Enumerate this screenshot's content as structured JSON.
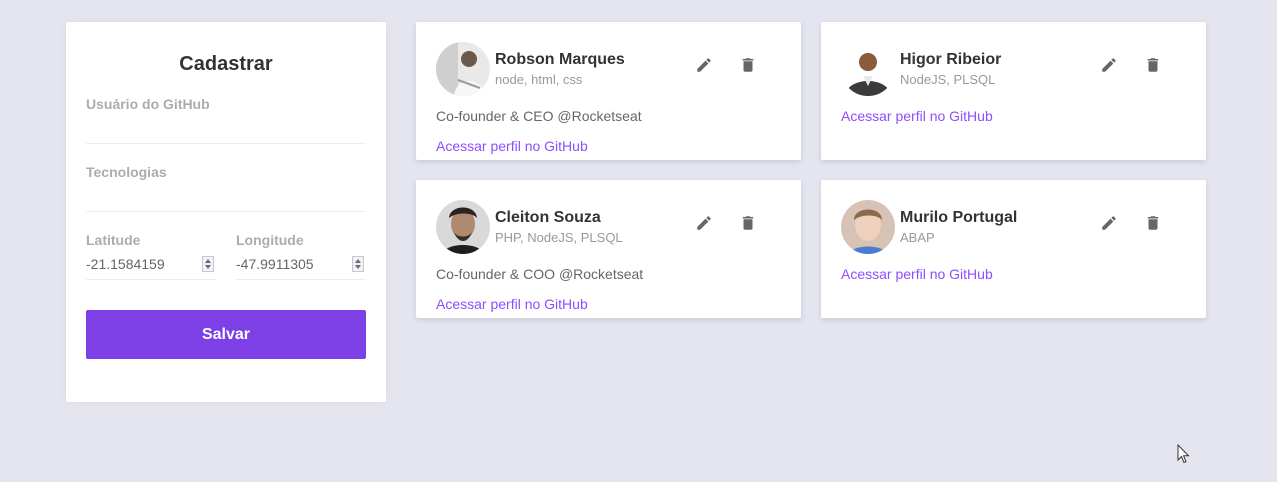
{
  "form": {
    "title": "Cadastrar",
    "github_user_label": "Usuário do GitHub",
    "github_user_value": "",
    "techs_label": "Tecnologias",
    "techs_value": "",
    "latitude_label": "Latitude",
    "latitude_value": "-21.1584159",
    "longitude_label": "Longitude",
    "longitude_value": "-47.9911305",
    "save_label": "Salvar"
  },
  "colors": {
    "background": "#e5e5ef",
    "accent": "#7d40e7",
    "link": "#8e4dff"
  },
  "devs": [
    {
      "name": "Robson Marques",
      "techs": "node, html, css",
      "bio": "Co-founder & CEO @Rocketseat",
      "link_label": "Acessar perfil no GitHub"
    },
    {
      "name": "Higor Ribeior",
      "techs": "NodeJS, PLSQL",
      "bio": "",
      "link_label": "Acessar perfil no GitHub"
    },
    {
      "name": "Cleiton Souza",
      "techs": "PHP, NodeJS, PLSQL",
      "bio": "Co-founder & COO @Rocketseat",
      "link_label": "Acessar perfil no GitHub"
    },
    {
      "name": "Murilo Portugal",
      "techs": "ABAP",
      "bio": "",
      "link_label": "Acessar perfil no GitHub"
    }
  ],
  "icons": {
    "edit": "pencil-icon",
    "delete": "trash-icon"
  }
}
